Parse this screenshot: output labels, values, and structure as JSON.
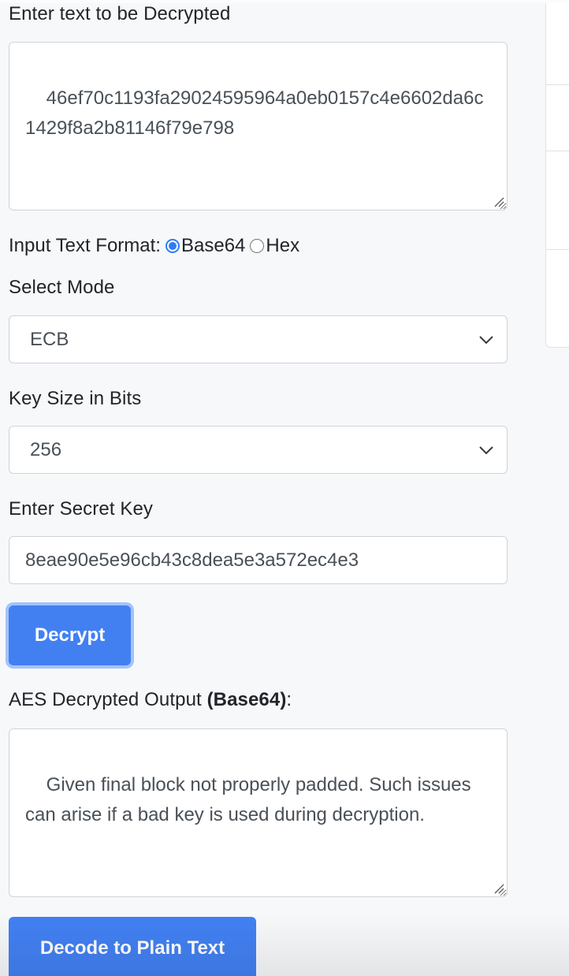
{
  "form": {
    "ciphertext_label": "Enter text to be Decrypted",
    "ciphertext_value": "46ef70c1193fa29024595964a0eb0157c4e6602da6c1429f8a2b81146f79e798",
    "input_format": {
      "label": "Input Text Format:",
      "options": [
        {
          "label": "Base64",
          "checked": true
        },
        {
          "label": "Hex",
          "checked": false
        }
      ]
    },
    "mode": {
      "label": "Select Mode",
      "selected": "ECB"
    },
    "key_size": {
      "label": "Key Size in Bits",
      "selected": "256"
    },
    "secret_key": {
      "label": "Enter Secret Key",
      "value": "8eae90e5e96cb43c8dea5e3a572ec4e3"
    },
    "decrypt_button": "Decrypt",
    "output": {
      "label_prefix": "AES Decrypted Output ",
      "label_format": "(Base64)",
      "label_suffix": ":",
      "value": "Given final block not properly padded. Such issues can arise if a bad key is used during decryption."
    },
    "decode_button": "Decode to Plain Text"
  },
  "colors": {
    "primary": "#4280f2",
    "focus_ring": "#a3c3f9",
    "radio_checked": "#2f7cf6",
    "page_background": "#f7f8fa",
    "input_border": "#ced4da"
  }
}
